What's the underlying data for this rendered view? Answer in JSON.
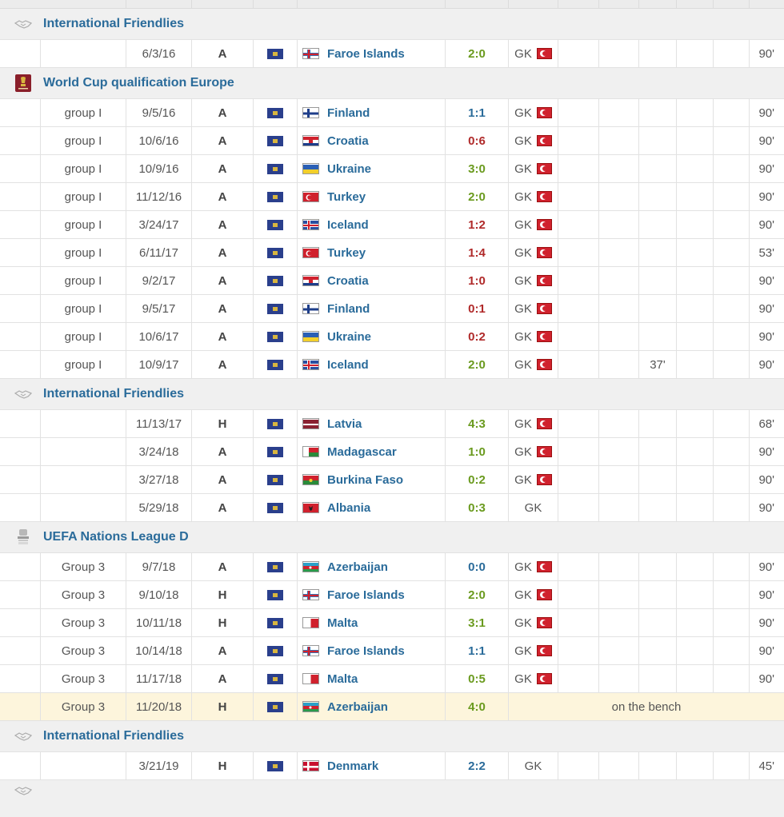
{
  "sections": [
    {
      "competition": "International Friendlies",
      "icon": "handshake-icon",
      "matches": [
        {
          "group": "",
          "date": "6/3/16",
          "venue": "A",
          "opponent": "Faroe Islands",
          "opp_flag": "faroe",
          "score": "2:0",
          "result": "win",
          "position": "GK",
          "captain": true,
          "goal": "",
          "minutes": "90'"
        }
      ]
    },
    {
      "competition": "World Cup qualification Europe",
      "icon": "world-cup-icon",
      "matches": [
        {
          "group": "group I",
          "date": "9/5/16",
          "venue": "A",
          "opponent": "Finland",
          "opp_flag": "finland",
          "score": "1:1",
          "result": "draw",
          "position": "GK",
          "captain": true,
          "goal": "",
          "minutes": "90'"
        },
        {
          "group": "group I",
          "date": "10/6/16",
          "venue": "A",
          "opponent": "Croatia",
          "opp_flag": "croatia",
          "score": "0:6",
          "result": "loss",
          "position": "GK",
          "captain": true,
          "goal": "",
          "minutes": "90'"
        },
        {
          "group": "group I",
          "date": "10/9/16",
          "venue": "A",
          "opponent": "Ukraine",
          "opp_flag": "ukraine",
          "score": "3:0",
          "result": "win",
          "position": "GK",
          "captain": true,
          "goal": "",
          "minutes": "90'"
        },
        {
          "group": "group I",
          "date": "11/12/16",
          "venue": "A",
          "opponent": "Turkey",
          "opp_flag": "turkey",
          "score": "2:0",
          "result": "win",
          "position": "GK",
          "captain": true,
          "goal": "",
          "minutes": "90'"
        },
        {
          "group": "group I",
          "date": "3/24/17",
          "venue": "A",
          "opponent": "Iceland",
          "opp_flag": "iceland",
          "score": "1:2",
          "result": "loss",
          "position": "GK",
          "captain": true,
          "goal": "",
          "minutes": "90'"
        },
        {
          "group": "group I",
          "date": "6/11/17",
          "venue": "A",
          "opponent": "Turkey",
          "opp_flag": "turkey",
          "score": "1:4",
          "result": "loss",
          "position": "GK",
          "captain": true,
          "goal": "",
          "minutes": "53'"
        },
        {
          "group": "group I",
          "date": "9/2/17",
          "venue": "A",
          "opponent": "Croatia",
          "opp_flag": "croatia",
          "score": "1:0",
          "result": "loss",
          "position": "GK",
          "captain": true,
          "goal": "",
          "minutes": "90'"
        },
        {
          "group": "group I",
          "date": "9/5/17",
          "venue": "A",
          "opponent": "Finland",
          "opp_flag": "finland",
          "score": "0:1",
          "result": "loss",
          "position": "GK",
          "captain": true,
          "goal": "",
          "minutes": "90'"
        },
        {
          "group": "group I",
          "date": "10/6/17",
          "venue": "A",
          "opponent": "Ukraine",
          "opp_flag": "ukraine",
          "score": "0:2",
          "result": "loss",
          "position": "GK",
          "captain": true,
          "goal": "",
          "minutes": "90'"
        },
        {
          "group": "group I",
          "date": "10/9/17",
          "venue": "A",
          "opponent": "Iceland",
          "opp_flag": "iceland",
          "score": "2:0",
          "result": "win",
          "position": "GK",
          "captain": true,
          "goal": "37'",
          "minutes": "90'"
        }
      ]
    },
    {
      "competition": "International Friendlies",
      "icon": "handshake-icon",
      "matches": [
        {
          "group": "",
          "date": "11/13/17",
          "venue": "H",
          "opponent": "Latvia",
          "opp_flag": "latvia",
          "score": "4:3",
          "result": "win",
          "position": "GK",
          "captain": true,
          "goal": "",
          "minutes": "68'"
        },
        {
          "group": "",
          "date": "3/24/18",
          "venue": "A",
          "opponent": "Madagascar",
          "opp_flag": "madagascar",
          "score": "1:0",
          "result": "win",
          "position": "GK",
          "captain": true,
          "goal": "",
          "minutes": "90'"
        },
        {
          "group": "",
          "date": "3/27/18",
          "venue": "A",
          "opponent": "Burkina Faso",
          "opp_flag": "burkina",
          "score": "0:2",
          "result": "win",
          "position": "GK",
          "captain": true,
          "goal": "",
          "minutes": "90'"
        },
        {
          "group": "",
          "date": "5/29/18",
          "venue": "A",
          "opponent": "Albania",
          "opp_flag": "albania",
          "score": "0:3",
          "result": "win",
          "position": "GK",
          "captain": false,
          "goal": "",
          "minutes": "90'"
        }
      ]
    },
    {
      "competition": "UEFA Nations League D",
      "icon": "nations-league-icon",
      "matches": [
        {
          "group": "Group 3",
          "date": "9/7/18",
          "venue": "A",
          "opponent": "Azerbaijan",
          "opp_flag": "azerbaijan",
          "score": "0:0",
          "result": "draw",
          "position": "GK",
          "captain": true,
          "goal": "",
          "minutes": "90'"
        },
        {
          "group": "Group 3",
          "date": "9/10/18",
          "venue": "H",
          "opponent": "Faroe Islands",
          "opp_flag": "faroe",
          "score": "2:0",
          "result": "win",
          "position": "GK",
          "captain": true,
          "goal": "",
          "minutes": "90'"
        },
        {
          "group": "Group 3",
          "date": "10/11/18",
          "venue": "H",
          "opponent": "Malta",
          "opp_flag": "malta",
          "score": "3:1",
          "result": "win",
          "position": "GK",
          "captain": true,
          "goal": "",
          "minutes": "90'"
        },
        {
          "group": "Group 3",
          "date": "10/14/18",
          "venue": "A",
          "opponent": "Faroe Islands",
          "opp_flag": "faroe",
          "score": "1:1",
          "result": "draw",
          "position": "GK",
          "captain": true,
          "goal": "",
          "minutes": "90'"
        },
        {
          "group": "Group 3",
          "date": "11/17/18",
          "venue": "A",
          "opponent": "Malta",
          "opp_flag": "malta",
          "score": "0:5",
          "result": "win",
          "position": "GK",
          "captain": true,
          "goal": "",
          "minutes": "90'"
        },
        {
          "group": "Group 3",
          "date": "11/20/18",
          "venue": "H",
          "opponent": "Azerbaijan",
          "opp_flag": "azerbaijan",
          "score": "4:0",
          "result": "win",
          "position": "",
          "captain": false,
          "goal": "",
          "minutes": "",
          "note": "on the bench",
          "highlight": true
        }
      ]
    },
    {
      "competition": "International Friendlies",
      "icon": "handshake-icon",
      "matches": [
        {
          "group": "",
          "date": "3/21/19",
          "venue": "H",
          "opponent": "Denmark",
          "opp_flag": "denmark",
          "score": "2:2",
          "result": "draw",
          "position": "GK",
          "captain": false,
          "goal": "",
          "minutes": "45'"
        }
      ]
    }
  ],
  "colors": {
    "win": "#6a9a1e",
    "loss": "#b02a2a",
    "draw": "#2a6b9a",
    "link": "#2a6b9a",
    "highlight": "#fdf5dc"
  }
}
